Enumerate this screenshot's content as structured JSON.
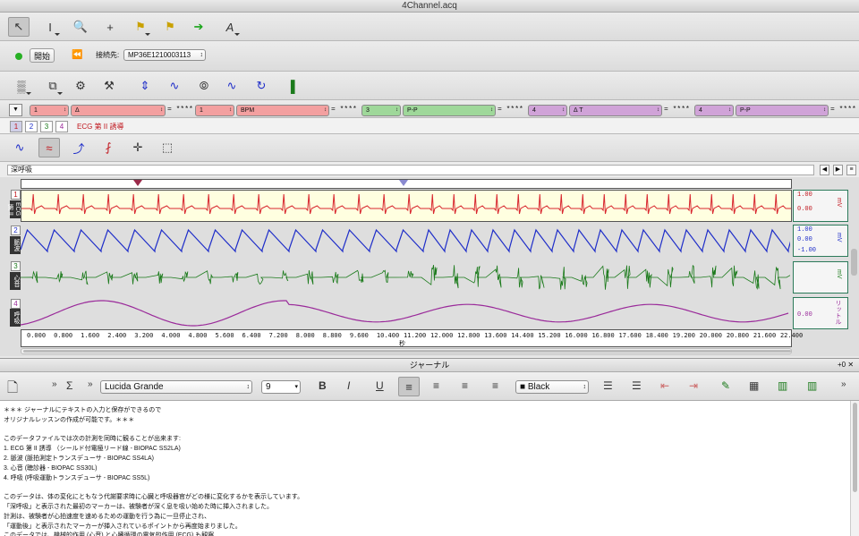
{
  "window": {
    "title": "4Channel.acq"
  },
  "toolbar1": {
    "tools": [
      "arrow-tool-icon",
      "ibeam-tool-icon",
      "zoom-tool-icon",
      "crosshair-tool-icon",
      "flag-tool-icon",
      "multi-flag-tool-icon",
      "go-arrow-icon",
      "annotate-tool-icon"
    ]
  },
  "toolbar2": {
    "start_label": "開始",
    "connection_label": "接続先:",
    "connection_value": "MP36E1210003113"
  },
  "measures": [
    {
      "channel": "1",
      "type": "Δ",
      "value": "****",
      "color": "#f3a0a0"
    },
    {
      "channel": "1",
      "type": "BPM",
      "value": "****",
      "color": "#f3a0a0"
    },
    {
      "channel": "3",
      "type": "P-P",
      "value": "****",
      "color": "#9fd89a"
    },
    {
      "channel": "4",
      "type": "Δ T",
      "value": "****",
      "color": "#d0a3d8"
    },
    {
      "channel": "4",
      "type": "P-P",
      "value": "****",
      "color": "#d0a3d8"
    }
  ],
  "channel_tabs": [
    "1",
    "2",
    "3",
    "4"
  ],
  "channel_selected_label": "ECG 第 II 誘導",
  "edit_field": {
    "value": "深呼吸"
  },
  "lanes": [
    {
      "num": "1",
      "label": "ECG 第 II",
      "top_val": "1.00",
      "mid_val": "0.00",
      "unit": "mV",
      "color": "#d8262e"
    },
    {
      "num": "2",
      "label": "脈波",
      "top_val": "1.00",
      "mid_val": "0.00",
      "bot_val": "-1.00",
      "unit": "mV",
      "color": "#1f2ec9"
    },
    {
      "num": "3",
      "label": "心音",
      "top_val": "",
      "mid_val": "",
      "unit": "mV",
      "color": "#1b7a1b"
    },
    {
      "num": "4",
      "label": "呼吸",
      "top_val": "",
      "mid_val": "0.00",
      "unit": "リットル",
      "color": "#9a2a9a"
    }
  ],
  "time_axis": {
    "ticks": [
      "0.000",
      "0.800",
      "1.600",
      "2.400",
      "3.200",
      "4.000",
      "4.800",
      "5.600",
      "6.400",
      "7.200",
      "8.000",
      "8.800",
      "9.600",
      "10.400",
      "11.200",
      "12.000",
      "12.800",
      "13.600",
      "14.400",
      "15.200",
      "16.000",
      "16.800",
      "17.600",
      "18.400",
      "19.200",
      "20.000",
      "20.800",
      "21.600",
      "22.400"
    ],
    "unit": "秒"
  },
  "journal": {
    "title": "ジャーナル",
    "font": "Lucida Grande",
    "size": "9",
    "color_label": "Black",
    "lines": [
      "＊＊＊ ジャーナルにテキストの入力と保存ができるので",
      "オリジナルレッスンの作成が可能です。＊＊＊",
      "",
      "このデータファイルでは次の計測を同時に観ることが出来ます:",
      "  1.  ECG 第 II 誘導 （シールド付電極リード線 - BIOPAC SS2LA)",
      "  2.  脈波 (脈拍測定トランスデューサ - BIOPAC SS4LA)",
      "  3.  心音 (聴診器 - BIOPAC SS30L)",
      "  4.  呼吸 (呼吸運動トランスデューサ - BIOPAC SS5L)",
      "",
      "このデータは、体の変化にともなう代謝要求時に心臓と呼吸器官がどの様に変化するかを表示しています。",
      "「深呼吸」と表示された最初のマーカーは、被験者が深く息を吸い始めた時に挿入されました。",
      "計測は、被験者が心拍速度を速めるための運動を行う為に一旦停止され、",
      "「運動後」と表示されたマーカーが挿入されているポイントから再度始まりました。",
      "このデータでは、機械的作用 (心音) と心臓循環の電気的作用 (ECG) も観察..."
    ]
  }
}
